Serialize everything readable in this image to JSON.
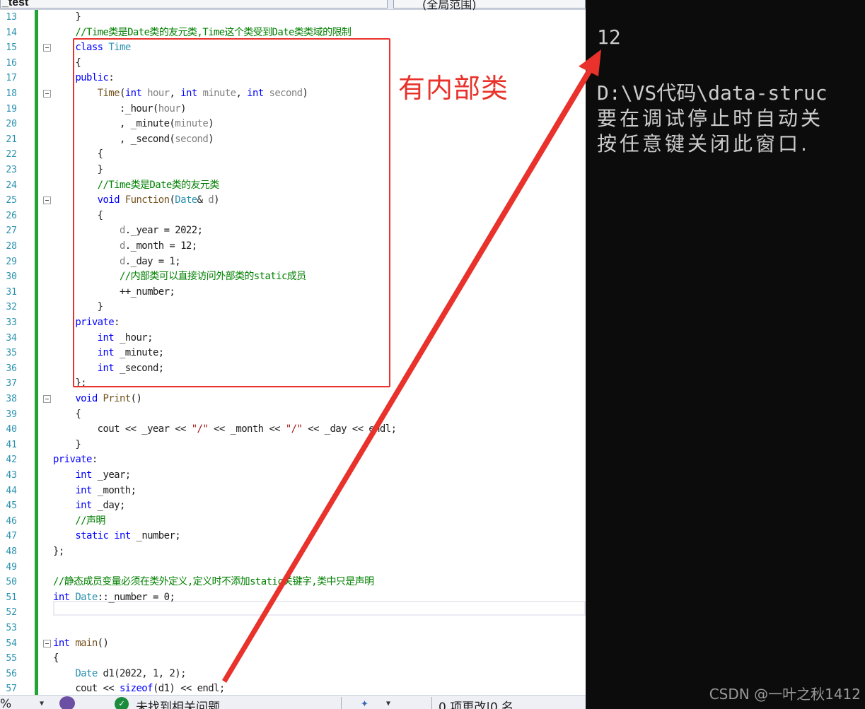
{
  "tabs": {
    "file_tab": "_test",
    "scope_dropdown": "(全局范围)"
  },
  "annotation": {
    "label": "有内部类",
    "color": "#e8322b"
  },
  "editor_lines": [
    {
      "n": "13",
      "html": "    }",
      "fold": false
    },
    {
      "n": "14",
      "html": "    <span class='cm'>//Time类是Date类的友元类,Time这个类受到Date类类域的限制</span>",
      "fold": false
    },
    {
      "n": "15",
      "html": "    <span class='kw'>class</span> <span class='ty'>Time</span>",
      "fold": true
    },
    {
      "n": "16",
      "html": "    {",
      "fold": false
    },
    {
      "n": "17",
      "html": "    <span class='kw'>public</span>:",
      "fold": false
    },
    {
      "n": "18",
      "html": "        <span class='fn'>Time</span>(<span class='kw'>int</span> <span class='pm'>hour</span>, <span class='kw'>int</span> <span class='pm'>minute</span>, <span class='kw'>int</span> <span class='pm'>second</span>)",
      "fold": true
    },
    {
      "n": "19",
      "html": "            :_hour(<span class='pm'>hour</span>)",
      "fold": false
    },
    {
      "n": "20",
      "html": "            , _minute(<span class='pm'>minute</span>)",
      "fold": false
    },
    {
      "n": "21",
      "html": "            , _second(<span class='pm'>second</span>)",
      "fold": false
    },
    {
      "n": "22",
      "html": "        {",
      "fold": false
    },
    {
      "n": "23",
      "html": "        }",
      "fold": false
    },
    {
      "n": "24",
      "html": "        <span class='cm'>//Time类是Date类的友元类</span>",
      "fold": false
    },
    {
      "n": "25",
      "html": "        <span class='kw'>void</span> <span class='fn'>Function</span>(<span class='ty'>Date</span>&amp; <span class='pm'>d</span>)",
      "fold": true
    },
    {
      "n": "26",
      "html": "        {",
      "fold": false
    },
    {
      "n": "27",
      "html": "            <span class='pm'>d</span>._year = 2022;",
      "fold": false
    },
    {
      "n": "28",
      "html": "            <span class='pm'>d</span>._month = 12;",
      "fold": false
    },
    {
      "n": "29",
      "html": "            <span class='pm'>d</span>._day = 1;",
      "fold": false
    },
    {
      "n": "30",
      "html": "            <span class='cm'>//内部类可以直接访问外部类的static成员</span>",
      "fold": false
    },
    {
      "n": "31",
      "html": "            ++_number;",
      "fold": false
    },
    {
      "n": "32",
      "html": "        }",
      "fold": false
    },
    {
      "n": "33",
      "html": "    <span class='kw'>private</span>:",
      "fold": false
    },
    {
      "n": "34",
      "html": "        <span class='kw'>int</span> _hour;",
      "fold": false
    },
    {
      "n": "35",
      "html": "        <span class='kw'>int</span> _minute;",
      "fold": false
    },
    {
      "n": "36",
      "html": "        <span class='kw'>int</span> _second;",
      "fold": false
    },
    {
      "n": "37",
      "html": "    };",
      "fold": false
    },
    {
      "n": "38",
      "html": "    <span class='kw'>void</span> <span class='fn'>Print</span>()",
      "fold": true
    },
    {
      "n": "39",
      "html": "    {",
      "fold": false
    },
    {
      "n": "40",
      "html": "        cout &lt;&lt; _year &lt;&lt; <span class='str'>\"/\"</span> &lt;&lt; _month &lt;&lt; <span class='str'>\"/\"</span> &lt;&lt; _day &lt;&lt; endl;",
      "fold": false
    },
    {
      "n": "41",
      "html": "    }",
      "fold": false
    },
    {
      "n": "42",
      "html": "<span class='kw'>private</span>:",
      "fold": false
    },
    {
      "n": "43",
      "html": "    <span class='kw'>int</span> _year;",
      "fold": false
    },
    {
      "n": "44",
      "html": "    <span class='kw'>int</span> _month;",
      "fold": false
    },
    {
      "n": "45",
      "html": "    <span class='kw'>int</span> _day;",
      "fold": false
    },
    {
      "n": "46",
      "html": "    <span class='cm'>//声明</span>",
      "fold": false
    },
    {
      "n": "47",
      "html": "    <span class='kw'>static</span> <span class='kw'>int</span> _number;",
      "fold": false
    },
    {
      "n": "48",
      "html": "};",
      "fold": false
    },
    {
      "n": "49",
      "html": "",
      "fold": false
    },
    {
      "n": "50",
      "html": "<span class='cm'>//静态成员变量必须在类外定义,定义时不添加static关键字,类中只是声明</span>",
      "fold": false
    },
    {
      "n": "51",
      "html": "<span class='kw'>int</span> <span class='ty'>Date</span>::_number = 0;",
      "fold": false
    },
    {
      "n": "52",
      "html": "",
      "fold": false
    },
    {
      "n": "53",
      "html": "",
      "fold": false
    },
    {
      "n": "54",
      "html": "<span class='kw'>int</span> <span class='fn'>main</span>()",
      "fold": true
    },
    {
      "n": "55",
      "html": "{",
      "fold": false
    },
    {
      "n": "56",
      "html": "    <span class='ty'>Date</span> d1(2022, 1, 2);",
      "fold": false
    },
    {
      "n": "57",
      "html": "    cout &lt;&lt; <span class='kw'>sizeof</span>(d1) &lt;&lt; endl;",
      "fold": false
    }
  ],
  "statusbar": {
    "zoom": "%",
    "issues": "未找到相关问题",
    "changes": "0 项更改|0 名"
  },
  "console": {
    "output_value": "12",
    "path_line": "D:\\VS代码\\data-struc",
    "line2": "要在调试停止时自动关",
    "line3": "按任意键关闭此窗口."
  },
  "watermark": "CSDN @一叶之秋1412"
}
